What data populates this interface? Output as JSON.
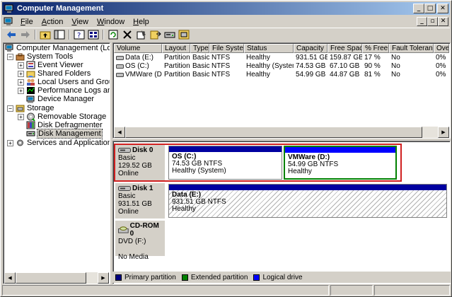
{
  "window": {
    "title": "Computer Management"
  },
  "menu": [
    {
      "label": "File",
      "u": "F",
      "rest": "ile"
    },
    {
      "label": "Action",
      "u": "A",
      "rest": "ction"
    },
    {
      "label": "View",
      "u": "V",
      "rest": "iew"
    },
    {
      "label": "Window",
      "u": "W",
      "rest": "indow"
    },
    {
      "label": "Help",
      "u": "H",
      "rest": "elp"
    }
  ],
  "tree": {
    "root": "Computer Management (Local)",
    "system_tools": "System Tools",
    "event_viewer": "Event Viewer",
    "shared_folders": "Shared Folders",
    "local_users": "Local Users and Groups",
    "perf_logs": "Performance Logs and Alerts",
    "device_manager": "Device Manager",
    "storage": "Storage",
    "removable_storage": "Removable Storage",
    "disk_defrag": "Disk Defragmenter",
    "disk_management": "Disk Management",
    "services": "Services and Applications"
  },
  "volumes": {
    "columns": [
      "Volume",
      "Layout",
      "Type",
      "File System",
      "Status",
      "Capacity",
      "Free Space",
      "% Free",
      "Fault Tolerance",
      "Ove"
    ],
    "rows": [
      [
        "Data (E:)",
        "Partition",
        "Basic",
        "NTFS",
        "Healthy",
        "931.51 GB",
        "159.87 GB",
        "17 %",
        "No",
        "0%"
      ],
      [
        "OS (C:)",
        "Partition",
        "Basic",
        "NTFS",
        "Healthy (System)",
        "74.53 GB",
        "67.10 GB",
        "90 %",
        "No",
        "0%"
      ],
      [
        "VMWare (D:)",
        "Partition",
        "Basic",
        "NTFS",
        "Healthy",
        "54.99 GB",
        "44.87 GB",
        "81 %",
        "No",
        "0%"
      ]
    ]
  },
  "disks": {
    "disk0": {
      "name": "Disk 0",
      "type": "Basic",
      "size": "129.52 GB",
      "status": "Online",
      "p1": {
        "name": "OS  (C:)",
        "size": "74.53 GB NTFS",
        "status": "Healthy (System)"
      },
      "p2": {
        "name": "VMWare  (D:)",
        "size": "54.99 GB NTFS",
        "status": "Healthy"
      }
    },
    "disk1": {
      "name": "Disk 1",
      "type": "Basic",
      "size": "931.51 GB",
      "status": "Online",
      "p1": {
        "name": "Data  (E:)",
        "size": "931.51 GB NTFS",
        "status": "Healthy"
      }
    },
    "cdrom0": {
      "name": "CD-ROM 0",
      "type": "DVD (F:)",
      "status": "No Media"
    }
  },
  "legend": {
    "primary": "Primary partition",
    "extended": "Extended partition",
    "logical": "Logical drive",
    "colors": {
      "primary": "#000080",
      "extended": "#008000",
      "logical": "#0000ff"
    }
  }
}
